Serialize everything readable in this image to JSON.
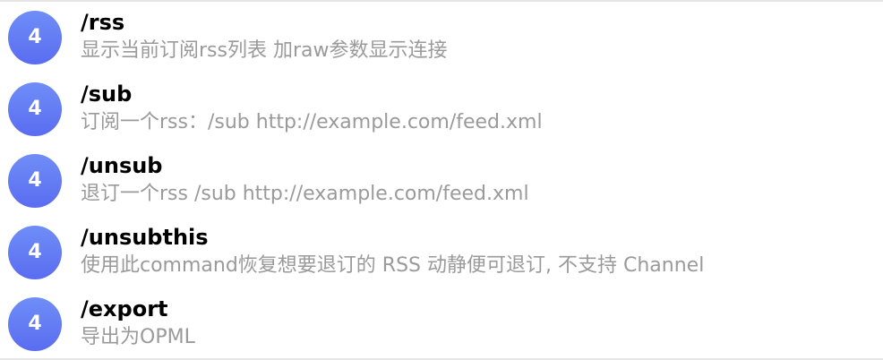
{
  "colors": {
    "avatar_top": "#6f8ef7",
    "avatar_bottom": "#5a6cf0",
    "command_text": "#000000",
    "description_text": "#9a9a9a",
    "divider": "#e6e6e6"
  },
  "commands": [
    {
      "avatar": "4",
      "name": "/rss",
      "description": "显示当前订阅rss列表 加raw参数显示连接"
    },
    {
      "avatar": "4",
      "name": "/sub",
      "description": "订阅一个rss：/sub http://example.com/feed.xml"
    },
    {
      "avatar": "4",
      "name": "/unsub",
      "description": "退订一个rss /sub http://example.com/feed.xml"
    },
    {
      "avatar": "4",
      "name": "/unsubthis",
      "description": "使用此command恢复想要退订的 RSS 动静便可退订, 不支持 Channel"
    },
    {
      "avatar": "4",
      "name": "/export",
      "description": "导出为OPML"
    }
  ]
}
